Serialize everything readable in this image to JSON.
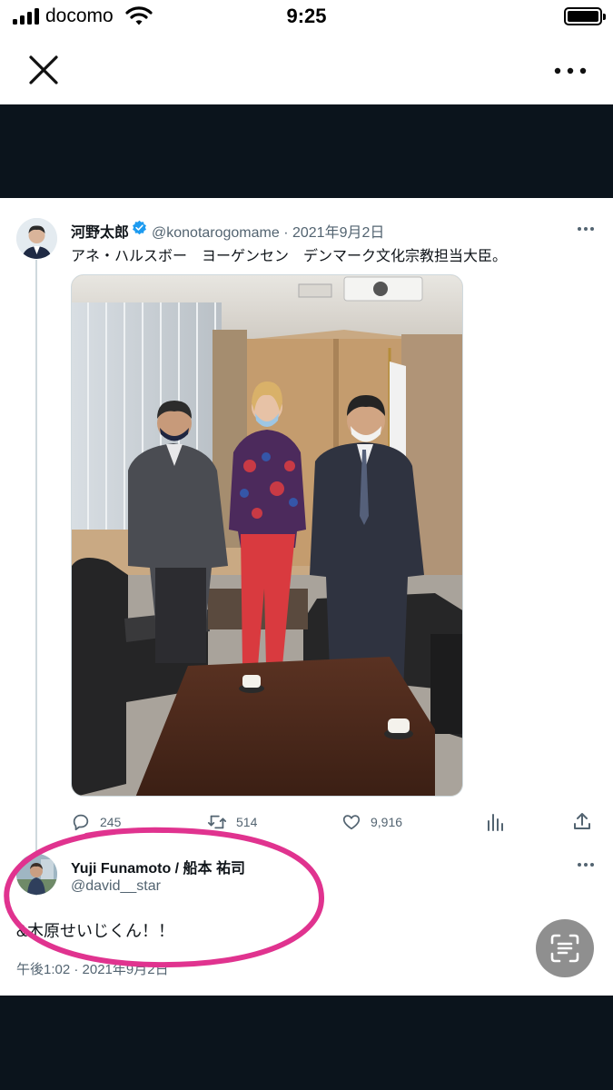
{
  "status_bar": {
    "carrier": "docomo",
    "time": "9:25"
  },
  "viewer": {
    "close_icon": "close-icon",
    "more_icon": "more-horizontal-icon"
  },
  "tweet": {
    "author_name": "河野太郎",
    "handle_date": "@konotarogomame · 2021年9月2日",
    "verified": true,
    "text": "アネ・ハルスボー　ヨーゲンセン　デンマーク文化宗教担当大臣。",
    "actions": {
      "replies": "245",
      "retweets": "514",
      "likes": "9,916"
    }
  },
  "reply": {
    "author_name": "Yuji Funamoto / 船本 祐司",
    "handle": "@david__star",
    "text": "&木原せいじくん！！",
    "timestamp": "午後1:02 · 2021年9月2日"
  },
  "colors": {
    "dark_band": "#0b141c",
    "verified_blue": "#1d9bf0",
    "secondary_text": "#536471",
    "annotation_pink": "#e0338f"
  }
}
